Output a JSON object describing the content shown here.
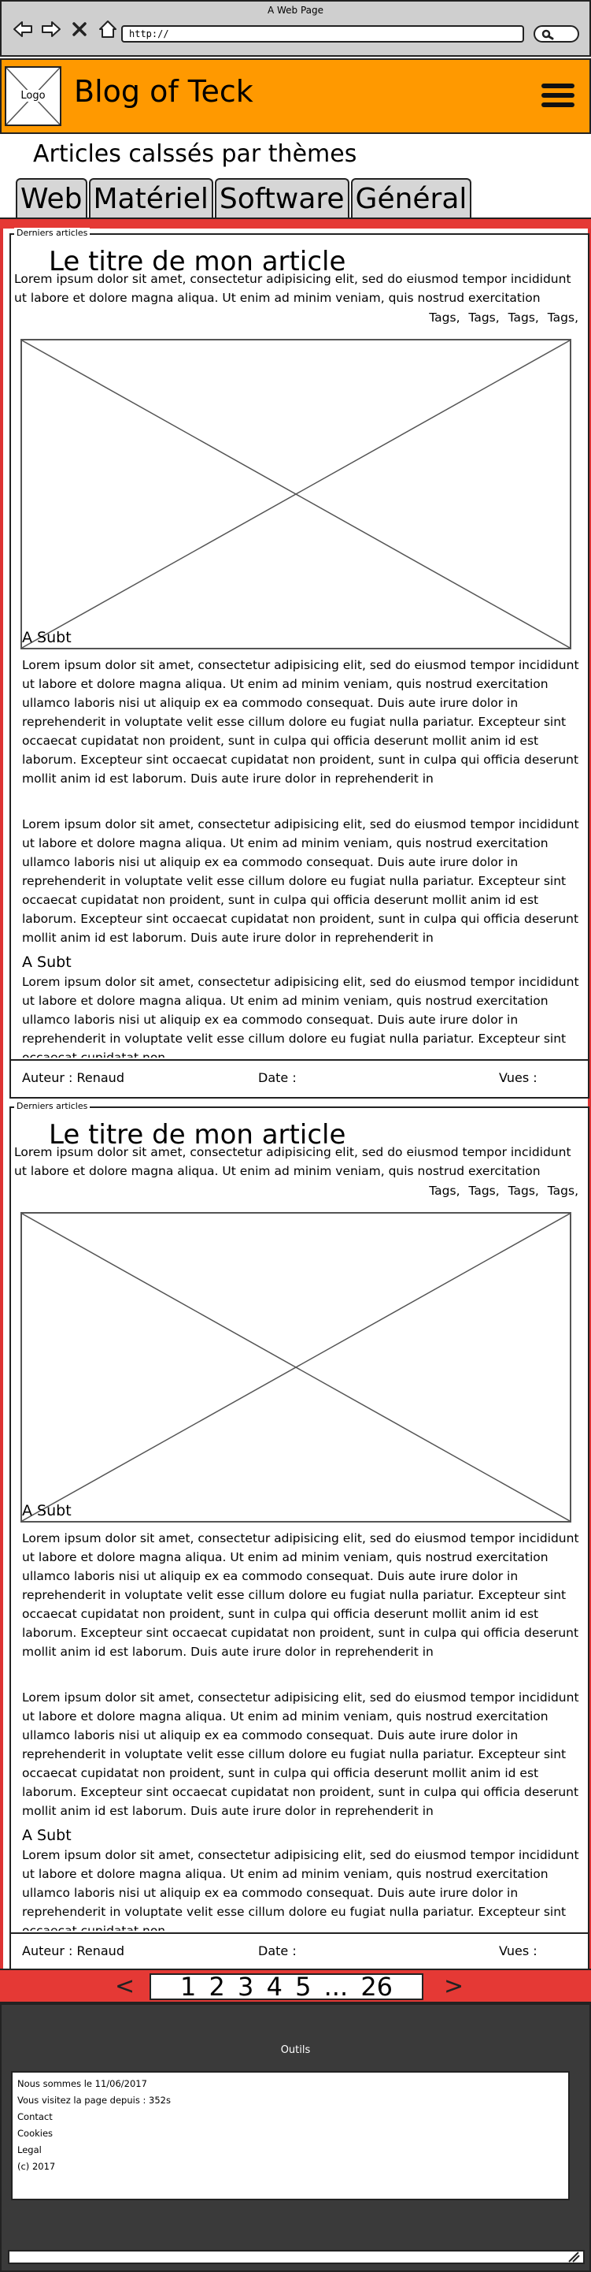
{
  "browser": {
    "title": "A Web Page",
    "url": "http://"
  },
  "header": {
    "logo_label": "Logo",
    "site_title": "Blog of Teck"
  },
  "themes": {
    "title": "Articles calssés par thèmes",
    "tabs": [
      "Web",
      "Matériel",
      "Software",
      "Général"
    ]
  },
  "articles": [
    {
      "section_label": "Derniers articles",
      "title": "Le titre de mon article",
      "excerpt": "Lorem ipsum dolor sit amet, consectetur adipisicing elit, sed do eiusmod tempor incididunt ut labore et dolore magna aliqua. Ut enim ad minim veniam, quis nostrud exercitation ullamco laboris nisi ut aliquip ex ea commodo",
      "tags": "Tags, Tags, Tags, Tags,",
      "paragraph1": "Lorem ipsum dolor sit amet, consectetur adipisicing elit, sed do eiusmod tempor incididunt ut labore et dolore magna aliqua. Ut enim ad minim veniam, quis nostrud exercitation ullamco laboris nisi ut aliquip ex ea commodo consequat. Duis aute irure dolor in reprehenderit in voluptate velit esse cillum dolore eu fugiat nulla pariatur. Excepteur sint occaecat cupidatat non proident, sunt in culpa qui officia deserunt mollit anim id est laborum. Excepteur sint occaecat cupidatat non proident, sunt in culpa qui officia deserunt mollit anim id est laborum. Duis aute irure dolor in reprehenderit in",
      "subtitle1": "A Subt",
      "paragraph2": "Lorem ipsum dolor sit amet, consectetur adipisicing elit, sed do eiusmod tempor incididunt ut labore et dolore magna aliqua. Ut enim ad minim veniam, quis nostrud exercitation ullamco laboris nisi ut aliquip ex ea commodo consequat. Duis aute irure dolor in reprehenderit in voluptate velit esse cillum dolore eu fugiat nulla pariatur. Excepteur sint occaecat cupidatat non proident, sunt in culpa qui officia deserunt mollit anim id est laborum. Excepteur sint occaecat cupidatat non proident, sunt in culpa qui officia deserunt mollit anim id est laborum. Duis aute irure dolor in reprehenderit in",
      "subtitle2": "A Subt",
      "paragraph3": "Lorem ipsum dolor sit amet, consectetur adipisicing elit, sed do eiusmod tempor incididunt ut labore et dolore magna aliqua. Ut enim ad minim veniam, quis nostrud exercitation ullamco laboris nisi ut aliquip ex ea commodo consequat. Duis aute irure dolor in reprehenderit in voluptate velit esse cillum dolore eu fugiat nulla pariatur. Excepteur sint occaecat cupidatat non",
      "author": "Auteur : Renaud",
      "date": "Date :",
      "views": "Vues :"
    },
    {
      "section_label": "Derniers articles",
      "title": "Le titre de mon article",
      "excerpt": "Lorem ipsum dolor sit amet, consectetur adipisicing elit, sed do eiusmod tempor incididunt ut labore et dolore magna aliqua. Ut enim ad minim veniam, quis nostrud exercitation ullamco laboris nisi ut aliquip ex ea commodo",
      "tags": "Tags, Tags, Tags, Tags,",
      "paragraph1": "Lorem ipsum dolor sit amet, consectetur adipisicing elit, sed do eiusmod tempor incididunt ut labore et dolore magna aliqua. Ut enim ad minim veniam, quis nostrud exercitation ullamco laboris nisi ut aliquip ex ea commodo consequat. Duis aute irure dolor in reprehenderit in voluptate velit esse cillum dolore eu fugiat nulla pariatur. Excepteur sint occaecat cupidatat non proident, sunt in culpa qui officia deserunt mollit anim id est laborum. Excepteur sint occaecat cupidatat non proident, sunt in culpa qui officia deserunt mollit anim id est laborum. Duis aute irure dolor in reprehenderit in",
      "subtitle1": "A Subt",
      "paragraph2": "Lorem ipsum dolor sit amet, consectetur adipisicing elit, sed do eiusmod tempor incididunt ut labore et dolore magna aliqua. Ut enim ad minim veniam, quis nostrud exercitation ullamco laboris nisi ut aliquip ex ea commodo consequat. Duis aute irure dolor in reprehenderit in voluptate velit esse cillum dolore eu fugiat nulla pariatur. Excepteur sint occaecat cupidatat non proident, sunt in culpa qui officia deserunt mollit anim id est laborum. Excepteur sint occaecat cupidatat non proident, sunt in culpa qui officia deserunt mollit anim id est laborum. Duis aute irure dolor in reprehenderit in",
      "subtitle2": "A Subt",
      "paragraph3": "Lorem ipsum dolor sit amet, consectetur adipisicing elit, sed do eiusmod tempor incididunt ut labore et dolore magna aliqua. Ut enim ad minim veniam, quis nostrud exercitation ullamco laboris nisi ut aliquip ex ea commodo consequat. Duis aute irure dolor in reprehenderit in voluptate velit esse cillum dolore eu fugiat nulla pariatur. Excepteur sint occaecat cupidatat non",
      "author": "Auteur : Renaud",
      "date": "Date :",
      "views": "Vues :"
    }
  ],
  "pagination": {
    "prev": "<",
    "pages": "1 2 3 4 5 ... 26",
    "next": ">"
  },
  "footer": {
    "title": "Outils",
    "lines": [
      "Nous sommes le 11/06/2017",
      "Vous visitez la page depuis : 352s",
      "Contact",
      "Cookies",
      "Legal",
      "(c) 2017"
    ]
  },
  "colors": {
    "header": "#ff9900",
    "accent_red": "#e53935",
    "footer_bg": "#3a3a3a",
    "chrome": "#cfcfcf"
  },
  "icons": [
    "back-arrow-icon",
    "forward-arrow-icon",
    "close-icon",
    "home-icon",
    "search-icon",
    "menu-icon",
    "resize-grip-icon"
  ]
}
